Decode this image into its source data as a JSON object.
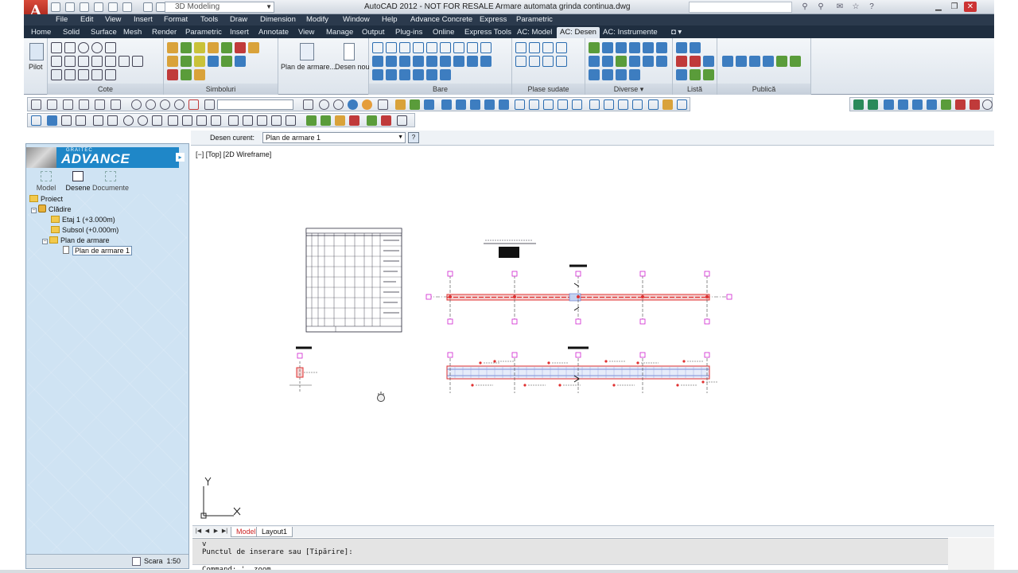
{
  "title_bar": {
    "app_logo": "A",
    "workspace": "3D Modeling",
    "title": "AutoCAD 2012 - NOT FOR RESALE    Armare automata grinda continua.dwg"
  },
  "menu": [
    "File",
    "Edit",
    "View",
    "Insert",
    "Format",
    "Tools",
    "Draw",
    "Dimension",
    "Modify",
    "Window",
    "Help",
    "Advance Concrete",
    "Express",
    "Parametric"
  ],
  "ribbon_tabs": [
    "Home",
    "Solid",
    "Surface",
    "Mesh",
    "Render",
    "Parametric",
    "Insert",
    "Annotate",
    "View",
    "Manage",
    "Output",
    "Plug-ins",
    "Online",
    "Express Tools",
    "AC: Model",
    "AC: Desen",
    "AC: Instrumente"
  ],
  "ribbon": {
    "pilot_label": "Pilot",
    "cote_title": "Cote",
    "simboluri_title": "Simboluri",
    "plan_de_armare_label": "Plan de armare...",
    "desen_nou_label": "Desen nou",
    "bare_title": "Bare",
    "plase_sudate_title": "Plase sudate",
    "diverse_title": "Diverse",
    "lista_title": "Listă",
    "publica_title": "Publică"
  },
  "palette": {
    "brand_small": "GRAITEC",
    "brand": "ADVANCE",
    "tabs": [
      "Model",
      "Desene",
      "Documente"
    ],
    "tree": [
      {
        "label": "Proiect"
      },
      {
        "label": "Clădire"
      },
      {
        "label": "Etaj 1 (+3.000m)"
      },
      {
        "label": "Subsol (+0.000m)"
      },
      {
        "label": "Plan de armare"
      },
      {
        "label": "Plan de armare 1"
      }
    ],
    "scale_label": "Scara",
    "scale_value": "1:50"
  },
  "drawing_bar": {
    "label": "Desen curent:",
    "current": "Plan de armare 1"
  },
  "viewport": {
    "label": "[−] [Top] [2D Wireframe]"
  },
  "ucs": {
    "x_label": "X",
    "y_label": "Y"
  },
  "layout_tabs": [
    "Model",
    "Layout1"
  ],
  "command_line": {
    "line1": "v",
    "line2": "Punctul de inserare sau [Tipărire]:",
    "prompt": "Command: '_.zoom"
  },
  "colors": {
    "menu_bg": "#2b3a4d",
    "ribbon_tab_bg": "#1f2e40",
    "palette_bg": "#cfe3f3",
    "brand_blue": "#1f87c8",
    "beam_red": "#e03030",
    "label_magenta": "#d020d0"
  }
}
